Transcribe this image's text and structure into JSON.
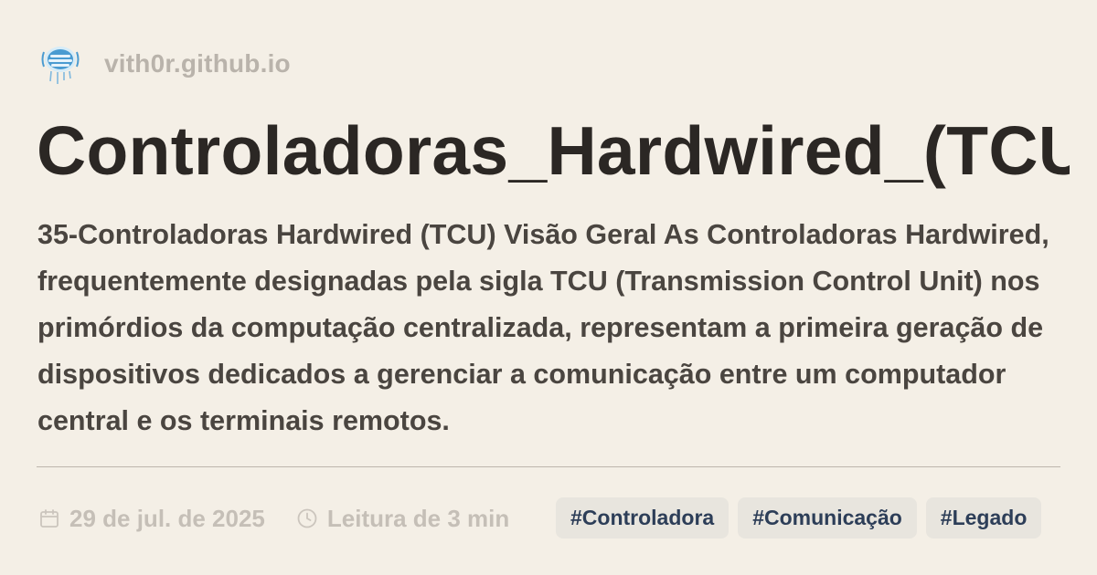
{
  "site": {
    "logo_icon": "signal-tower-logo-icon",
    "name": "vith0r.github.io"
  },
  "post": {
    "title": "Controladoras_Hardwired_(TCU",
    "description": "35-Controladoras Hardwired (TCU) Visão Geral As Controladoras Hardwired, frequentemente designadas pela sigla TCU (Transmission Control Unit) nos primórdios da computação centralizada, representam a primeira geração de dispositivos dedicados a gerenciar a comunicação entre um computador central e os terminais remotos.",
    "date": "29 de jul. de 2025",
    "reading_time": "Leitura de 3 min",
    "tags": [
      "#Controladora",
      "#Comunicação",
      "#Legado"
    ]
  },
  "colors": {
    "background": "#f4efe6",
    "title": "#2b2724",
    "description": "#4a4540",
    "muted": "#c5bfb7",
    "tag_background": "#e8e5de",
    "tag_text": "#2d3e58",
    "logo_accent": "#4a9bd1"
  }
}
